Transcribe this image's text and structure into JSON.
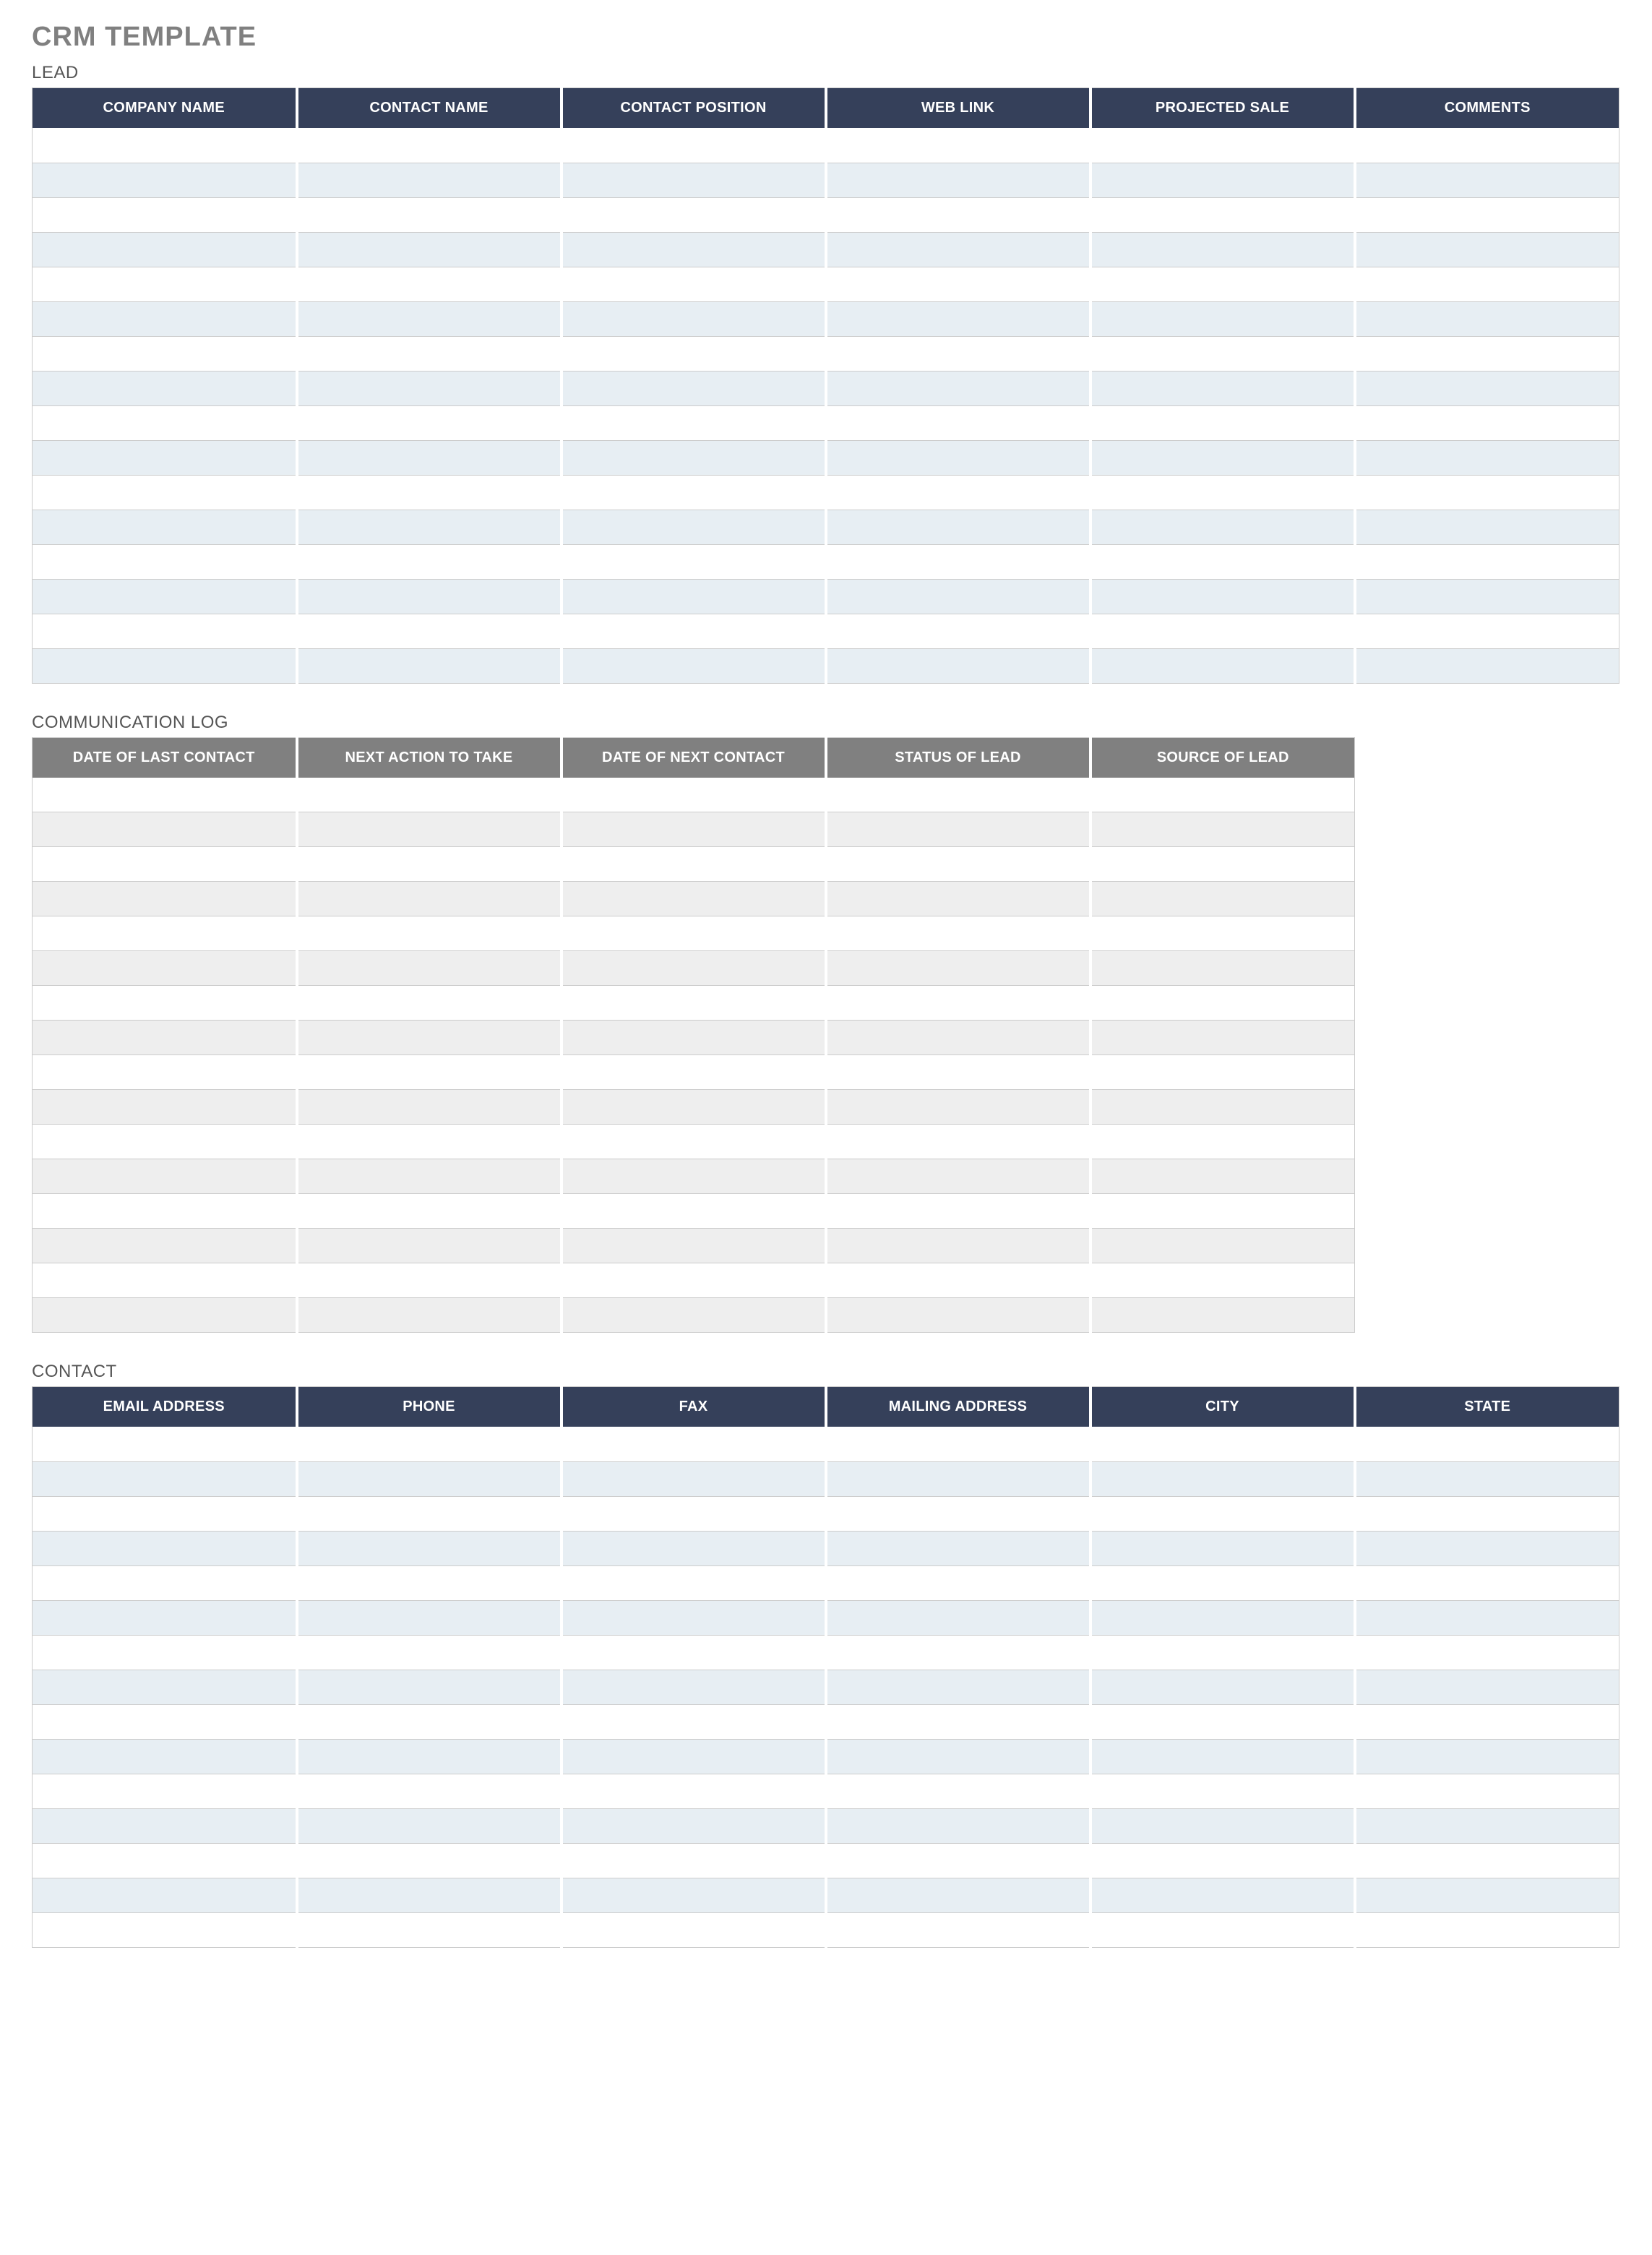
{
  "title": "CRM TEMPLATE",
  "sections": {
    "lead": {
      "label": "LEAD",
      "columns": [
        "COMPANY NAME",
        "CONTACT NAME",
        "CONTACT POSITION",
        "WEB LINK",
        "PROJECTED SALE",
        "COMMENTS"
      ],
      "row_count": 16,
      "rows": [
        [
          "",
          "",
          "",
          "",
          "",
          ""
        ],
        [
          "",
          "",
          "",
          "",
          "",
          ""
        ],
        [
          "",
          "",
          "",
          "",
          "",
          ""
        ],
        [
          "",
          "",
          "",
          "",
          "",
          ""
        ],
        [
          "",
          "",
          "",
          "",
          "",
          ""
        ],
        [
          "",
          "",
          "",
          "",
          "",
          ""
        ],
        [
          "",
          "",
          "",
          "",
          "",
          ""
        ],
        [
          "",
          "",
          "",
          "",
          "",
          ""
        ],
        [
          "",
          "",
          "",
          "",
          "",
          ""
        ],
        [
          "",
          "",
          "",
          "",
          "",
          ""
        ],
        [
          "",
          "",
          "",
          "",
          "",
          ""
        ],
        [
          "",
          "",
          "",
          "",
          "",
          ""
        ],
        [
          "",
          "",
          "",
          "",
          "",
          ""
        ],
        [
          "",
          "",
          "",
          "",
          "",
          ""
        ],
        [
          "",
          "",
          "",
          "",
          "",
          ""
        ],
        [
          "",
          "",
          "",
          "",
          "",
          ""
        ]
      ]
    },
    "communication_log": {
      "label": "COMMUNICATION LOG",
      "columns": [
        "DATE OF LAST CONTACT",
        "NEXT ACTION TO TAKE",
        "DATE OF NEXT CONTACT",
        "STATUS OF LEAD",
        "SOURCE OF LEAD"
      ],
      "row_count": 16,
      "rows": [
        [
          "",
          "",
          "",
          "",
          ""
        ],
        [
          "",
          "",
          "",
          "",
          ""
        ],
        [
          "",
          "",
          "",
          "",
          ""
        ],
        [
          "",
          "",
          "",
          "",
          ""
        ],
        [
          "",
          "",
          "",
          "",
          ""
        ],
        [
          "",
          "",
          "",
          "",
          ""
        ],
        [
          "",
          "",
          "",
          "",
          ""
        ],
        [
          "",
          "",
          "",
          "",
          ""
        ],
        [
          "",
          "",
          "",
          "",
          ""
        ],
        [
          "",
          "",
          "",
          "",
          ""
        ],
        [
          "",
          "",
          "",
          "",
          ""
        ],
        [
          "",
          "",
          "",
          "",
          ""
        ],
        [
          "",
          "",
          "",
          "",
          ""
        ],
        [
          "",
          "",
          "",
          "",
          ""
        ],
        [
          "",
          "",
          "",
          "",
          ""
        ],
        [
          "",
          "",
          "",
          "",
          ""
        ]
      ]
    },
    "contact": {
      "label": "CONTACT",
      "columns": [
        "EMAIL ADDRESS",
        "PHONE",
        "FAX",
        "MAILING ADDRESS",
        "CITY",
        "STATE"
      ],
      "row_count": 15,
      "rows": [
        [
          "",
          "",
          "",
          "",
          "",
          ""
        ],
        [
          "",
          "",
          "",
          "",
          "",
          ""
        ],
        [
          "",
          "",
          "",
          "",
          "",
          ""
        ],
        [
          "",
          "",
          "",
          "",
          "",
          ""
        ],
        [
          "",
          "",
          "",
          "",
          "",
          ""
        ],
        [
          "",
          "",
          "",
          "",
          "",
          ""
        ],
        [
          "",
          "",
          "",
          "",
          "",
          ""
        ],
        [
          "",
          "",
          "",
          "",
          "",
          ""
        ],
        [
          "",
          "",
          "",
          "",
          "",
          ""
        ],
        [
          "",
          "",
          "",
          "",
          "",
          ""
        ],
        [
          "",
          "",
          "",
          "",
          "",
          ""
        ],
        [
          "",
          "",
          "",
          "",
          "",
          ""
        ],
        [
          "",
          "",
          "",
          "",
          "",
          ""
        ],
        [
          "",
          "",
          "",
          "",
          "",
          ""
        ],
        [
          "",
          "",
          "",
          "",
          "",
          ""
        ]
      ]
    }
  },
  "layout": {
    "col_width_6": 366,
    "col_width_5": 366
  }
}
